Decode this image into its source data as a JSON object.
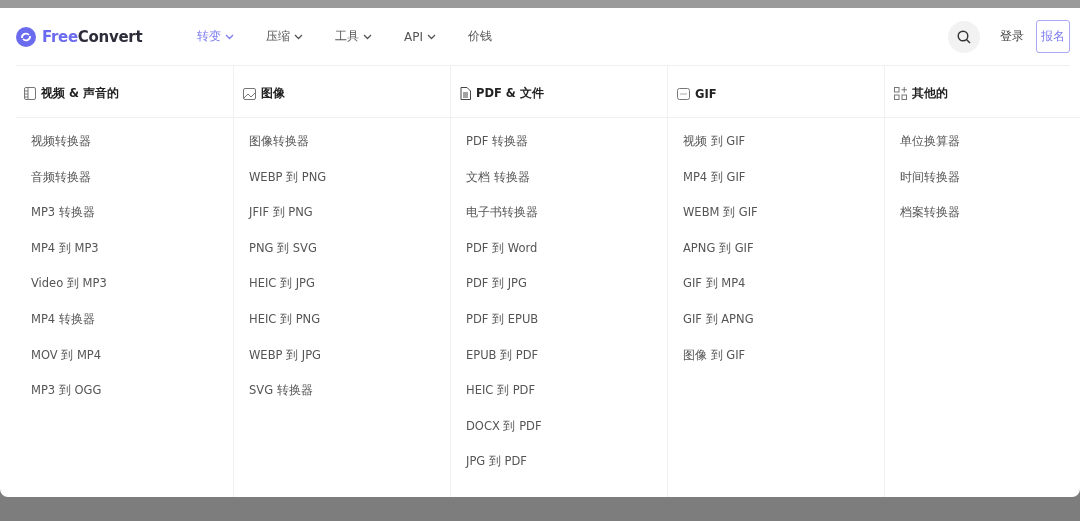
{
  "logo": {
    "accent": "Free",
    "rest": "Convert"
  },
  "nav": [
    {
      "label": "转变",
      "selected": true,
      "dropdown": true
    },
    {
      "label": "压缩",
      "selected": false,
      "dropdown": true
    },
    {
      "label": "工具",
      "selected": false,
      "dropdown": true
    },
    {
      "label": "API",
      "selected": false,
      "dropdown": true
    },
    {
      "label": "价钱",
      "selected": false,
      "dropdown": false
    }
  ],
  "login": "登录",
  "signup": "报名",
  "columns": [
    {
      "title": "视频 & 声音的",
      "items": [
        "视频转换器",
        "音频转换器",
        "MP3 转换器",
        "MP4 到 MP3",
        "Video 到 MP3",
        "MP4 转换器",
        "MOV 到 MP4",
        "MP3 到 OGG"
      ]
    },
    {
      "title": "图像",
      "items": [
        "图像转换器",
        "WEBP 到 PNG",
        "JFIF 到 PNG",
        "PNG 到 SVG",
        "HEIC 到 JPG",
        "HEIC 到 PNG",
        "WEBP 到 JPG",
        "SVG 转换器"
      ]
    },
    {
      "title": "PDF & 文件",
      "items": [
        "PDF 转换器",
        "文档 转换器",
        "电子书转换器",
        "PDF 到 Word",
        "PDF 到 JPG",
        "PDF 到 EPUB",
        "EPUB 到 PDF",
        "HEIC 到 PDF",
        "DOCX 到 PDF",
        "JPG 到 PDF"
      ]
    },
    {
      "title": "GIF",
      "items": [
        "视频 到 GIF",
        "MP4 到 GIF",
        "WEBM 到 GIF",
        "APNG 到 GIF",
        "GIF 到 MP4",
        "GIF 到 APNG",
        "图像 到 GIF"
      ]
    },
    {
      "title": "其他的",
      "items": [
        "单位换算器",
        "时间转换器",
        "档案转换器"
      ]
    }
  ]
}
